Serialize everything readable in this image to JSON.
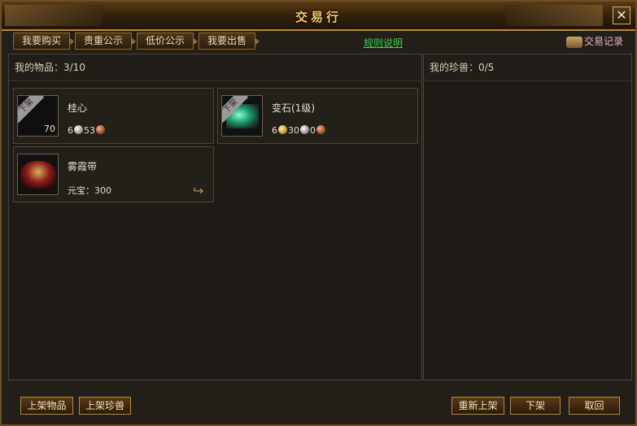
{
  "window": {
    "title": "交易行"
  },
  "tabs": [
    {
      "label": "我要购买"
    },
    {
      "label": "贵重公示"
    },
    {
      "label": "低价公示"
    },
    {
      "label": "我要出售"
    }
  ],
  "rules_link": "规则说明",
  "record_button": "交易记录",
  "my_items": {
    "header": "我的物品：3/10"
  },
  "my_pets": {
    "header": "我的珍兽：0/5"
  },
  "items": [
    {
      "name": "桂心",
      "badge": "下架",
      "quantity": "70",
      "price": {
        "gold": "",
        "silver": "6",
        "copper": "53"
      }
    },
    {
      "name": "变石(1级)",
      "badge": "下架",
      "quantity": "",
      "price": {
        "gold": "6",
        "silver": "30",
        "copper": "0"
      }
    },
    {
      "name": "雾霞带",
      "badge": "",
      "quantity": "",
      "price_text": "元宝：300"
    }
  ],
  "buttons": {
    "list_item": "上架物品",
    "list_pet": "上架珍兽",
    "relist": "重新上架",
    "delist": "下架",
    "cancel": "取回"
  }
}
